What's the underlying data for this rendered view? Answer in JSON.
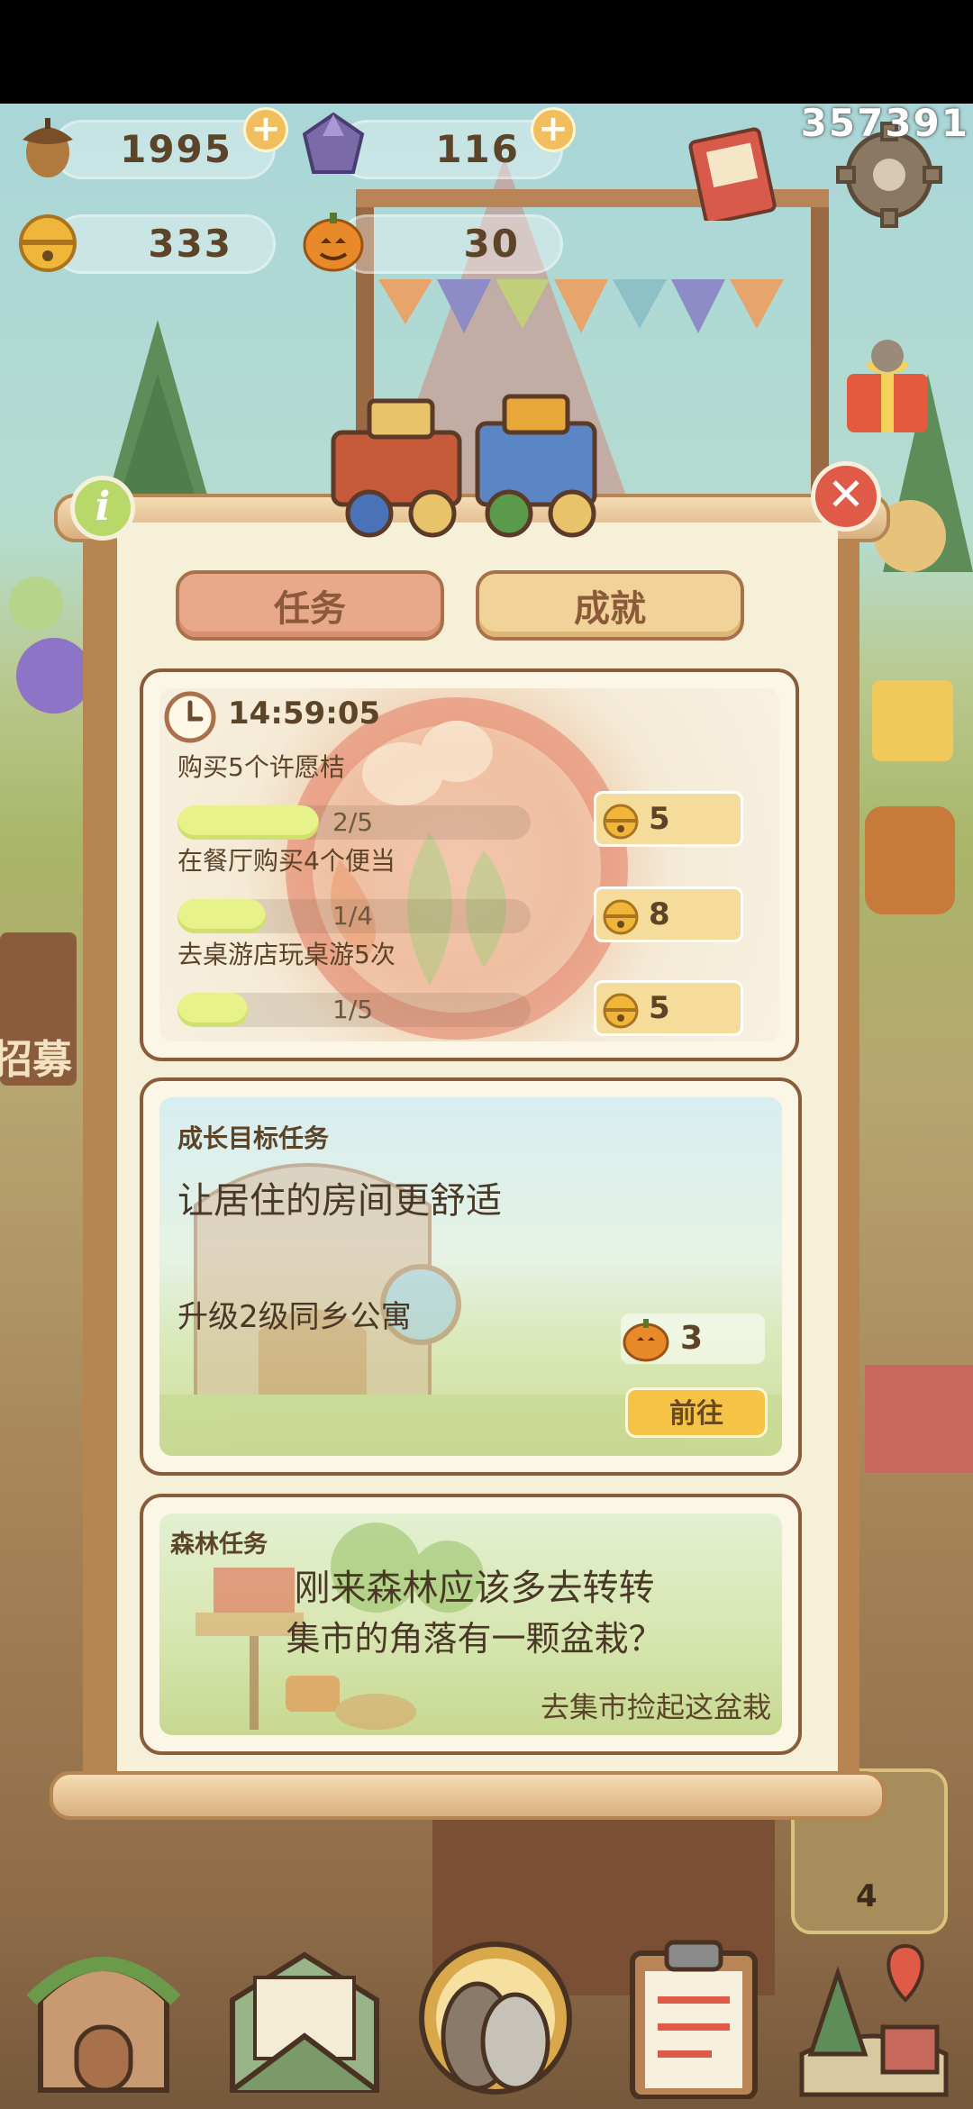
{
  "resources": {
    "acorn": "1995",
    "gem": "116",
    "bell": "333",
    "pumpkin": "30"
  },
  "counter": "357391",
  "tabs": {
    "tasks": "任务",
    "achievements": "成就"
  },
  "daily": {
    "timer": "14:59:05",
    "tasks": [
      {
        "label": "购买5个许愿桔",
        "progress_text": "2/5",
        "progress": 0.4,
        "reward": "5"
      },
      {
        "label": "在餐厅购买4个便当",
        "progress_text": "1/4",
        "progress": 0.25,
        "reward": "8"
      },
      {
        "label": "去桌游店玩桌游5次",
        "progress_text": "1/5",
        "progress": 0.2,
        "reward": "5"
      }
    ]
  },
  "growth": {
    "heading": "成长目标任务",
    "title": "让居住的房间更舒适",
    "task": "升级2级同乡公寓",
    "reward": "3",
    "go_label": "前往"
  },
  "forest": {
    "heading": "森林任务",
    "line1": "刚来森林应该多去转转",
    "line2": "集市的角落有一颗盆栽？",
    "action": "去集市捡起这盆栽"
  },
  "side": {
    "recruit": "招募",
    "count": "4"
  },
  "colors": {
    "tab_active": "#e8a98a",
    "tab_inactive": "#f1d39a",
    "go_button": "#f5c447",
    "progress_fill": "#e8f28a",
    "frame": "#b78552"
  }
}
